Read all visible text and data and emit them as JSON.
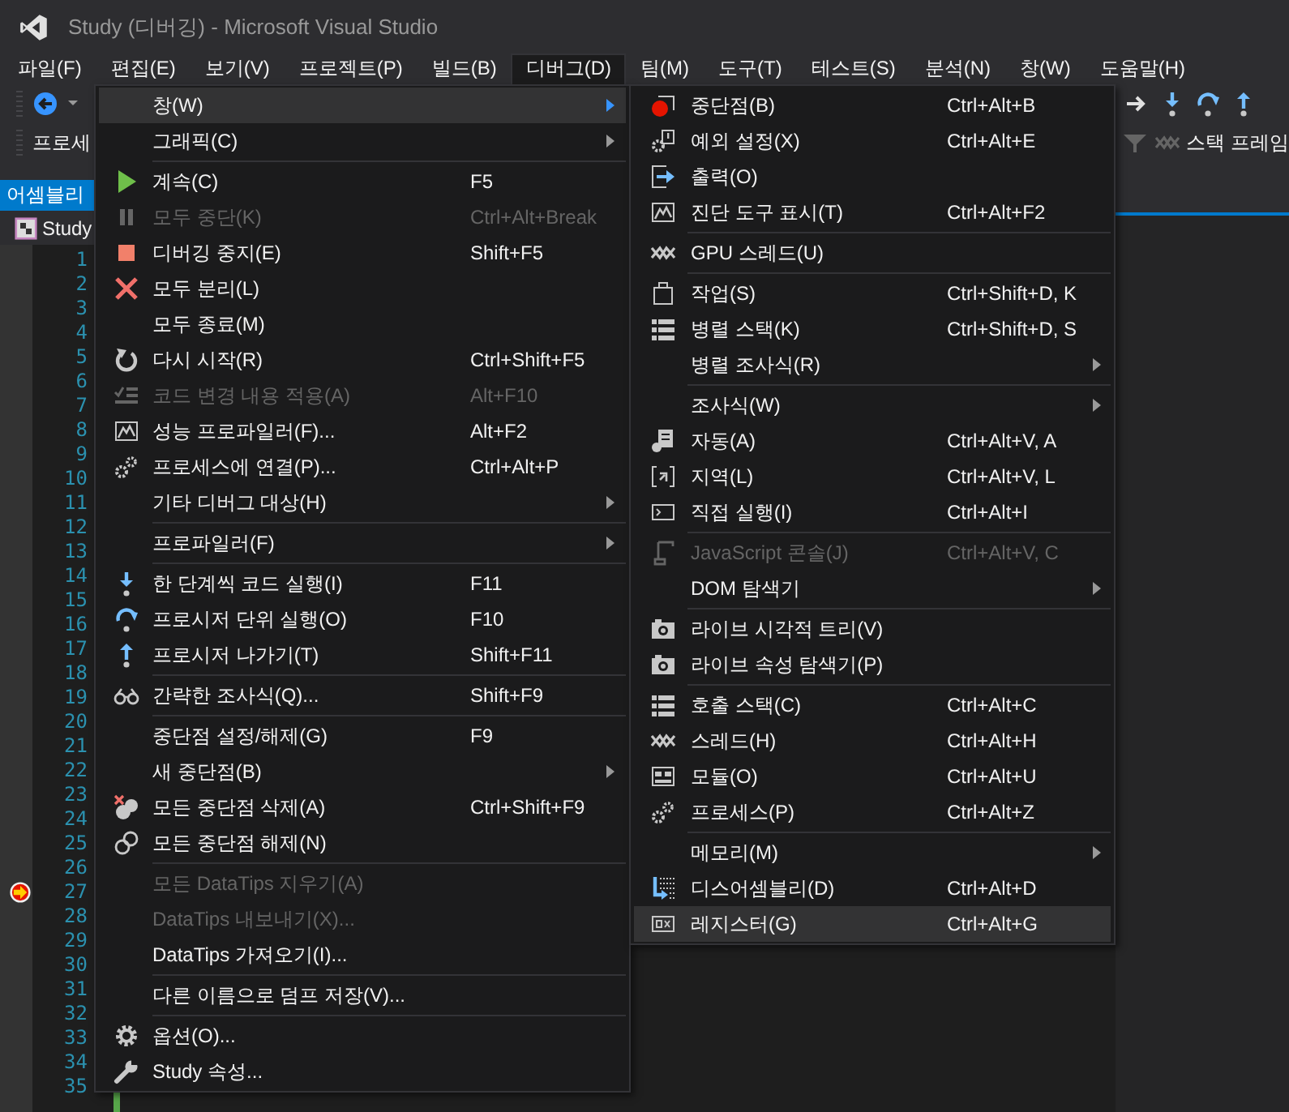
{
  "window": {
    "title": "Study (디버깅) - Microsoft Visual Studio"
  },
  "menubar": [
    {
      "label": "파일(F)",
      "selected": false
    },
    {
      "label": "편집(E)",
      "selected": false
    },
    {
      "label": "보기(V)",
      "selected": false
    },
    {
      "label": "프로젝트(P)",
      "selected": false
    },
    {
      "label": "빌드(B)",
      "selected": false
    },
    {
      "label": "디버그(D)",
      "selected": true
    },
    {
      "label": "팀(M)",
      "selected": false
    },
    {
      "label": "도구(T)",
      "selected": false
    },
    {
      "label": "테스트(S)",
      "selected": false
    },
    {
      "label": "분석(N)",
      "selected": false
    },
    {
      "label": "창(W)",
      "selected": false
    },
    {
      "label": "도움말(H)",
      "selected": false
    }
  ],
  "toolbar": {
    "process_label": "프로세",
    "stack_frame_label": "스택 프레임"
  },
  "tool_window_tab": "어셈블리",
  "document_tab": "Study",
  "editor_lines": [
    {
      "number": "1",
      "marker": false
    },
    {
      "number": "2",
      "marker": false
    },
    {
      "number": "3",
      "marker": false
    },
    {
      "number": "4",
      "marker": false
    },
    {
      "number": "5",
      "marker": false
    },
    {
      "number": "6",
      "marker": false
    },
    {
      "number": "7",
      "marker": false
    },
    {
      "number": "8",
      "marker": false
    },
    {
      "number": "9",
      "marker": false
    },
    {
      "number": "10",
      "marker": false
    },
    {
      "number": "11",
      "marker": false
    },
    {
      "number": "12",
      "marker": false
    },
    {
      "number": "13",
      "marker": false
    },
    {
      "number": "14",
      "marker": false
    },
    {
      "number": "15",
      "marker": false
    },
    {
      "number": "16",
      "marker": false
    },
    {
      "number": "17",
      "marker": false
    },
    {
      "number": "18",
      "marker": false
    },
    {
      "number": "19",
      "marker": false
    },
    {
      "number": "20",
      "marker": false
    },
    {
      "number": "21",
      "marker": false
    },
    {
      "number": "22",
      "marker": false
    },
    {
      "number": "23",
      "marker": false
    },
    {
      "number": "24",
      "marker": false
    },
    {
      "number": "25",
      "marker": false
    },
    {
      "number": "26",
      "marker": false
    },
    {
      "number": "27",
      "marker": true
    },
    {
      "number": "28",
      "marker": false
    },
    {
      "number": "29",
      "marker": false
    },
    {
      "number": "30",
      "marker": false
    },
    {
      "number": "31",
      "marker": false
    },
    {
      "number": "32",
      "marker": false
    },
    {
      "number": "33",
      "marker": false
    },
    {
      "number": "34",
      "marker": false
    },
    {
      "number": "35",
      "marker": false
    }
  ],
  "debug_menu": {
    "items": [
      {
        "kind": "item",
        "label": "창(W)",
        "submenu": true,
        "disabled": false,
        "selected": true
      },
      {
        "kind": "item",
        "label": "그래픽(C)",
        "submenu": true,
        "disabled": false,
        "selected": false
      },
      {
        "kind": "separator"
      },
      {
        "kind": "item",
        "label": "계속(C)",
        "shortcut": "F5",
        "submenu": false,
        "disabled": false,
        "selected": false
      },
      {
        "kind": "item",
        "label": "모두 중단(K)",
        "shortcut": "Ctrl+Alt+Break",
        "submenu": false,
        "disabled": true,
        "selected": false
      },
      {
        "kind": "item",
        "label": "디버깅 중지(E)",
        "shortcut": "Shift+F5",
        "submenu": false,
        "disabled": false,
        "selected": false
      },
      {
        "kind": "item",
        "label": "모두 분리(L)",
        "submenu": false,
        "disabled": false,
        "selected": false
      },
      {
        "kind": "item",
        "label": "모두 종료(M)",
        "submenu": false,
        "disabled": false,
        "selected": false
      },
      {
        "kind": "item",
        "label": "다시 시작(R)",
        "shortcut": "Ctrl+Shift+F5",
        "submenu": false,
        "disabled": false,
        "selected": false
      },
      {
        "kind": "item",
        "label": "코드 변경 내용 적용(A)",
        "shortcut": "Alt+F10",
        "submenu": false,
        "disabled": true,
        "selected": false
      },
      {
        "kind": "item",
        "label": "성능 프로파일러(F)...",
        "shortcut": "Alt+F2",
        "submenu": false,
        "disabled": false,
        "selected": false
      },
      {
        "kind": "item",
        "label": "프로세스에 연결(P)...",
        "shortcut": "Ctrl+Alt+P",
        "submenu": false,
        "disabled": false,
        "selected": false
      },
      {
        "kind": "item",
        "label": "기타 디버그 대상(H)",
        "submenu": true,
        "disabled": false,
        "selected": false
      },
      {
        "kind": "separator"
      },
      {
        "kind": "item",
        "label": "프로파일러(F)",
        "submenu": true,
        "disabled": false,
        "selected": false
      },
      {
        "kind": "separator"
      },
      {
        "kind": "item",
        "label": "한 단계씩 코드 실행(I)",
        "shortcut": "F11",
        "submenu": false,
        "disabled": false,
        "selected": false
      },
      {
        "kind": "item",
        "label": "프로시저 단위 실행(O)",
        "shortcut": "F10",
        "submenu": false,
        "disabled": false,
        "selected": false
      },
      {
        "kind": "item",
        "label": "프로시저 나가기(T)",
        "shortcut": "Shift+F11",
        "submenu": false,
        "disabled": false,
        "selected": false
      },
      {
        "kind": "separator"
      },
      {
        "kind": "item",
        "label": "간략한 조사식(Q)...",
        "shortcut": "Shift+F9",
        "submenu": false,
        "disabled": false,
        "selected": false
      },
      {
        "kind": "separator"
      },
      {
        "kind": "item",
        "label": "중단점 설정/해제(G)",
        "shortcut": "F9",
        "submenu": false,
        "disabled": false,
        "selected": false
      },
      {
        "kind": "item",
        "label": "새 중단점(B)",
        "submenu": true,
        "disabled": false,
        "selected": false
      },
      {
        "kind": "item",
        "label": "모든 중단점 삭제(A)",
        "shortcut": "Ctrl+Shift+F9",
        "submenu": false,
        "disabled": false,
        "selected": false
      },
      {
        "kind": "item",
        "label": "모든 중단점 해제(N)",
        "submenu": false,
        "disabled": false,
        "selected": false
      },
      {
        "kind": "separator"
      },
      {
        "kind": "item",
        "label": "모든 DataTips 지우기(A)",
        "submenu": false,
        "disabled": true,
        "selected": false
      },
      {
        "kind": "item",
        "label": "DataTips 내보내기(X)...",
        "submenu": false,
        "disabled": true,
        "selected": false
      },
      {
        "kind": "item",
        "label": "DataTips 가져오기(I)...",
        "submenu": false,
        "disabled": false,
        "selected": false
      },
      {
        "kind": "separator"
      },
      {
        "kind": "item",
        "label": "다른 이름으로 덤프 저장(V)...",
        "submenu": false,
        "disabled": false,
        "selected": false
      },
      {
        "kind": "separator"
      },
      {
        "kind": "item",
        "label": "옵션(O)...",
        "submenu": false,
        "disabled": false,
        "selected": false
      },
      {
        "kind": "item",
        "label": "Study 속성...",
        "submenu": false,
        "disabled": false,
        "selected": false
      }
    ]
  },
  "window_submenu": {
    "items": [
      {
        "kind": "item",
        "label": "중단점(B)",
        "shortcut": "Ctrl+Alt+B",
        "submenu": false,
        "disabled": false,
        "selected": false
      },
      {
        "kind": "item",
        "label": "예외 설정(X)",
        "shortcut": "Ctrl+Alt+E",
        "submenu": false,
        "disabled": false,
        "selected": false
      },
      {
        "kind": "item",
        "label": "출력(O)",
        "submenu": false,
        "disabled": false,
        "selected": false
      },
      {
        "kind": "item",
        "label": "진단 도구 표시(T)",
        "shortcut": "Ctrl+Alt+F2",
        "submenu": false,
        "disabled": false,
        "selected": false
      },
      {
        "kind": "separator"
      },
      {
        "kind": "item",
        "label": "GPU 스레드(U)",
        "submenu": false,
        "disabled": false,
        "selected": false
      },
      {
        "kind": "separator"
      },
      {
        "kind": "item",
        "label": "작업(S)",
        "shortcut": "Ctrl+Shift+D, K",
        "submenu": false,
        "disabled": false,
        "selected": false
      },
      {
        "kind": "item",
        "label": "병렬 스택(K)",
        "shortcut": "Ctrl+Shift+D, S",
        "submenu": false,
        "disabled": false,
        "selected": false
      },
      {
        "kind": "item",
        "label": "병렬 조사식(R)",
        "submenu": true,
        "disabled": false,
        "selected": false
      },
      {
        "kind": "separator"
      },
      {
        "kind": "item",
        "label": "조사식(W)",
        "submenu": true,
        "disabled": false,
        "selected": false
      },
      {
        "kind": "item",
        "label": "자동(A)",
        "shortcut": "Ctrl+Alt+V, A",
        "submenu": false,
        "disabled": false,
        "selected": false
      },
      {
        "kind": "item",
        "label": "지역(L)",
        "shortcut": "Ctrl+Alt+V, L",
        "submenu": false,
        "disabled": false,
        "selected": false
      },
      {
        "kind": "item",
        "label": "직접 실행(I)",
        "shortcut": "Ctrl+Alt+I",
        "submenu": false,
        "disabled": false,
        "selected": false
      },
      {
        "kind": "separator"
      },
      {
        "kind": "item",
        "label": "JavaScript 콘솔(J)",
        "shortcut": "Ctrl+Alt+V, C",
        "submenu": false,
        "disabled": true,
        "selected": false
      },
      {
        "kind": "item",
        "label": "DOM 탐색기",
        "submenu": true,
        "disabled": false,
        "selected": false
      },
      {
        "kind": "separator"
      },
      {
        "kind": "item",
        "label": "라이브 시각적 트리(V)",
        "submenu": false,
        "disabled": false,
        "selected": false
      },
      {
        "kind": "item",
        "label": "라이브 속성 탐색기(P)",
        "submenu": false,
        "disabled": false,
        "selected": false
      },
      {
        "kind": "separator"
      },
      {
        "kind": "item",
        "label": "호출 스택(C)",
        "shortcut": "Ctrl+Alt+C",
        "submenu": false,
        "disabled": false,
        "selected": false
      },
      {
        "kind": "item",
        "label": "스레드(H)",
        "shortcut": "Ctrl+Alt+H",
        "submenu": false,
        "disabled": false,
        "selected": false
      },
      {
        "kind": "item",
        "label": "모듈(O)",
        "shortcut": "Ctrl+Alt+U",
        "submenu": false,
        "disabled": false,
        "selected": false
      },
      {
        "kind": "item",
        "label": "프로세스(P)",
        "shortcut": "Ctrl+Alt+Z",
        "submenu": false,
        "disabled": false,
        "selected": false
      },
      {
        "kind": "separator"
      },
      {
        "kind": "item",
        "label": "메모리(M)",
        "submenu": true,
        "disabled": false,
        "selected": false
      },
      {
        "kind": "item",
        "label": "디스어셈블리(D)",
        "shortcut": "Ctrl+Alt+D",
        "submenu": false,
        "disabled": false,
        "selected": false
      },
      {
        "kind": "item",
        "label": "레지스터(G)",
        "shortcut": "Ctrl+Alt+G",
        "submenu": false,
        "disabled": false,
        "selected": true
      }
    ]
  }
}
